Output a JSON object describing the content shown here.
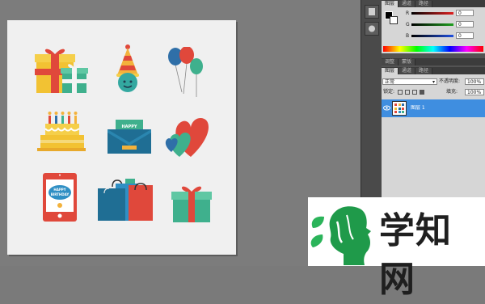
{
  "panels": {
    "top_tabs": [
      "图层",
      "通道",
      "路径"
    ],
    "color": {
      "sliders": [
        {
          "label": "R",
          "value": "0",
          "color": "#e02020"
        },
        {
          "label": "G",
          "value": "0",
          "color": "#20a020"
        },
        {
          "label": "B",
          "value": "0",
          "color": "#2050e0"
        }
      ],
      "foreground": "#000000",
      "background": "#ffffff"
    },
    "adjust_tabs": [
      "调整",
      "蒙版"
    ],
    "layers_tabs": [
      "图层",
      "通道",
      "路径"
    ],
    "layers": {
      "blend_mode": "正常",
      "opacity_label": "不透明度:",
      "opacity": "100%",
      "lock_label": "锁定:",
      "fill_label": "填充:",
      "fill": "100%",
      "items": [
        {
          "name": "图层 1"
        }
      ]
    }
  },
  "canvas": {
    "icons": [
      {
        "name": "gift-boxes-icon"
      },
      {
        "name": "party-hat-icon"
      },
      {
        "name": "balloons-icon"
      },
      {
        "name": "birthday-cake-icon"
      },
      {
        "name": "card-envelope-icon",
        "text": "HAPPY"
      },
      {
        "name": "hearts-icon"
      },
      {
        "name": "tablet-card-icon",
        "text": [
          "HAPPY",
          "BIRTHDAY"
        ]
      },
      {
        "name": "shopping-bags-icon"
      },
      {
        "name": "green-gift-icon"
      }
    ]
  },
  "watermark": {
    "text": "学知网"
  }
}
